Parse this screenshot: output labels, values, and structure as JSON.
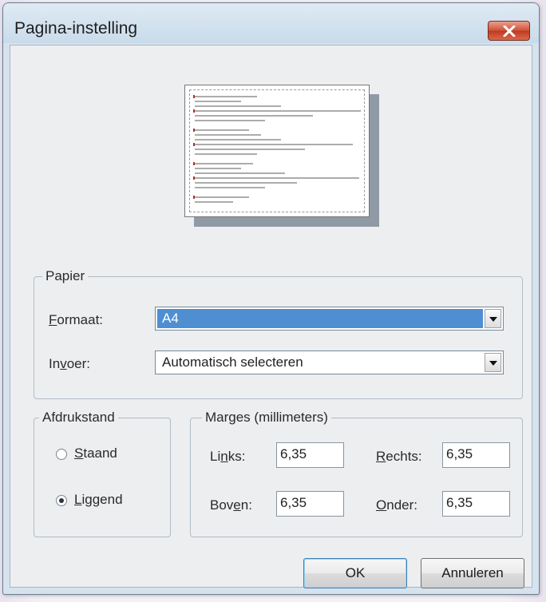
{
  "window": {
    "title": "Pagina-instelling"
  },
  "icons": {
    "close": "close-x-icon"
  },
  "colors": {
    "titlebar": "#d6e3ee",
    "close_button": "#c94a33",
    "selection": "#4f8ed1"
  },
  "paper": {
    "legend": "Papier",
    "format": {
      "label_pre": "",
      "label_key": "F",
      "label_post": "ormaat:",
      "value": "A4"
    },
    "source": {
      "label_pre": "In",
      "label_key": "v",
      "label_post": "oer:",
      "value": "Automatisch selecteren"
    }
  },
  "orientation": {
    "legend": "Afdrukstand",
    "portrait": {
      "key": "S",
      "rest": "taand",
      "checked": false
    },
    "landscape": {
      "key": "L",
      "rest": "iggend",
      "checked": true
    }
  },
  "margins": {
    "legend": "Marges (millimeters)",
    "left": {
      "pre": "Li",
      "key": "n",
      "post": "ks:",
      "value": "6,35"
    },
    "right": {
      "pre": "",
      "key": "R",
      "post": "echts:",
      "value": "6,35"
    },
    "top": {
      "pre": "Bov",
      "key": "e",
      "post": "n:",
      "value": "6,35"
    },
    "bottom": {
      "pre": "",
      "key": "O",
      "post": "nder:",
      "value": "6,35"
    }
  },
  "buttons": {
    "ok": "OK",
    "cancel": "Annuleren"
  }
}
